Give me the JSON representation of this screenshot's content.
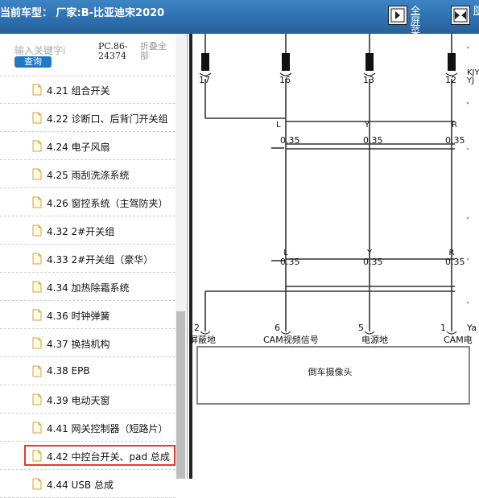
{
  "header": {
    "title": "当前车型：  厂家:B-比亚迪宋2020",
    "fullscreen_label_1": "全屏",
    "fullscreen_label_2": "菜单",
    "hide_label": "隐"
  },
  "search": {
    "placeholder": "输入关键字i",
    "query_label": "查询",
    "model_code": "PC.86-24374",
    "collapse_all": "折叠全部"
  },
  "tree": [
    {
      "label": "4.21 组合开关"
    },
    {
      "label": "4.22 诊断口、后背门开关组"
    },
    {
      "label": "4.24 电子风扇"
    },
    {
      "label": "4.25 雨刮洗涤系统"
    },
    {
      "label": "4.26 窗控系统（主驾防夹）"
    },
    {
      "label": "4.32 2#开关组"
    },
    {
      "label": "4.33 2#开关组（豪华）"
    },
    {
      "label": "4.34 加热除霜系统"
    },
    {
      "label": "4.36 时钟弹簧"
    },
    {
      "label": "4.37 换挡机构"
    },
    {
      "label": "4.38 EPB"
    },
    {
      "label": "4.39 电动天窗"
    },
    {
      "label": "4.41 网关控制器（短路片）"
    },
    {
      "label": "4.42 中控台开关、pad 总成",
      "selected": true
    },
    {
      "label": "4.44 USB 总成"
    }
  ],
  "diagram": {
    "top_pins": [
      "17",
      "16",
      "13",
      "12"
    ],
    "right_codes": [
      "KJY",
      "YJ"
    ],
    "wire_size": "0.35",
    "wire_colors": [
      "L",
      "Y",
      "R"
    ],
    "bottom_pins": [
      "2",
      "6",
      "5",
      "1"
    ],
    "bottom_tail": "Ya",
    "pin_labels": [
      "屏蔽地",
      "CAM视频信号",
      "电源地",
      "CAM电"
    ],
    "component": "倒车摄像头"
  }
}
